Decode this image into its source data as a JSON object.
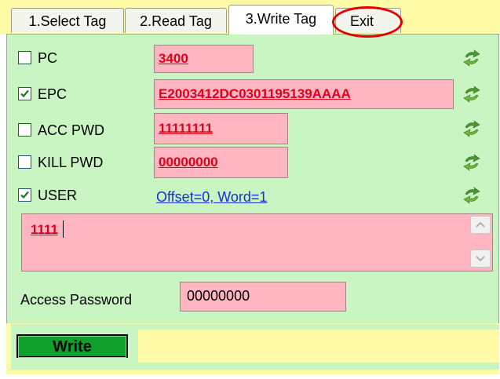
{
  "tabs": [
    {
      "label": "1.Select Tag",
      "active": false
    },
    {
      "label": "2.Read Tag",
      "active": false
    },
    {
      "label": "3.Write Tag",
      "active": true
    },
    {
      "label": "Exit",
      "active": false
    }
  ],
  "rows": {
    "pc": {
      "label": "PC",
      "checked": false,
      "value": "3400"
    },
    "epc": {
      "label": "EPC",
      "checked": true,
      "value": "E2003412DC0301195139AAAA"
    },
    "acc_pwd": {
      "label": "ACC PWD",
      "checked": false,
      "value": "11111111"
    },
    "kill_pwd": {
      "label": "KILL PWD",
      "checked": false,
      "value": "00000000"
    },
    "user": {
      "label": "USER",
      "checked": true,
      "link": "Offset=0, Word=1"
    }
  },
  "user_data": "1111",
  "access_password": {
    "label": "Access Password",
    "value": "00000000"
  },
  "write_button": "Write",
  "status_text": "",
  "icons": {
    "refresh": "refresh-icon",
    "check": "check-icon",
    "scroll_up": "chevron-up-icon",
    "scroll_down": "chevron-down-icon"
  },
  "colors": {
    "panel": "#c8f5c1",
    "field": "#ffb6c1",
    "tabbar": "#fffaa6",
    "value_text": "#e0001b",
    "button": "#0ea02a",
    "highlight": "#e00000"
  }
}
